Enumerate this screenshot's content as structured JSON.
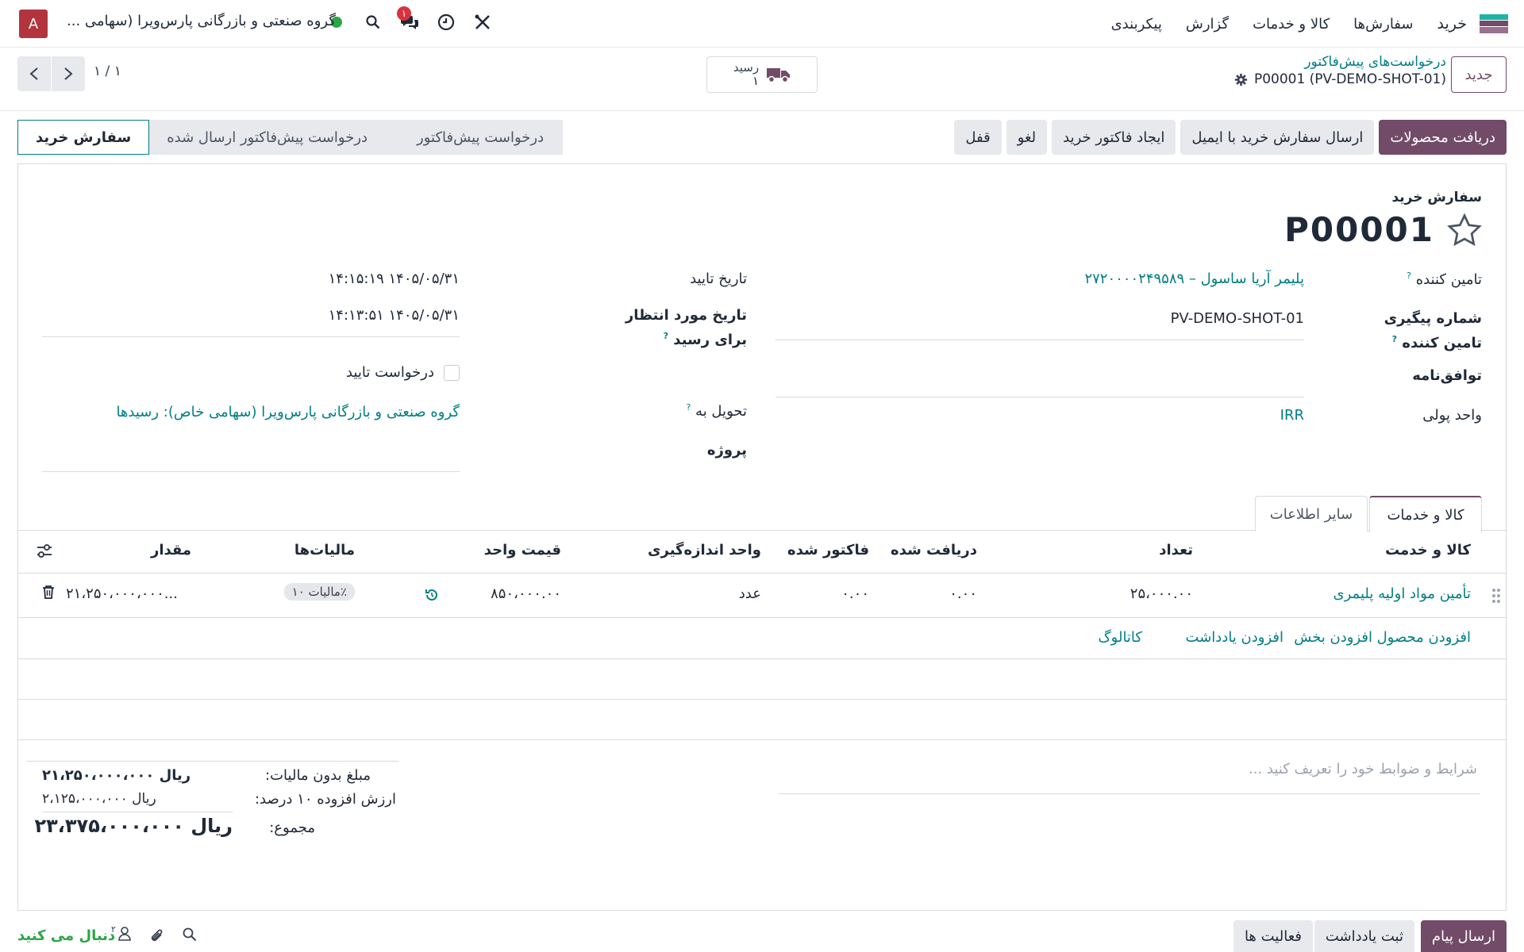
{
  "nav": {
    "app_name": "خرید",
    "menu": [
      "سفارش‌ها",
      "کالا و خدمات",
      "گزارش",
      "پیکربندی"
    ],
    "company": "گروه صنعتی و بازرگانی پارس‌ویرا (سهامی ...",
    "avatar_letter": "A",
    "message_badge": "۱"
  },
  "control": {
    "new_button": "جدید",
    "breadcrumb_parent": "درخواست‌های پیش‌فاکتور",
    "breadcrumb_current": "P00001 (PV-DEMO-SHOT-01)",
    "receipt_label": "رسید",
    "receipt_count": "۱",
    "pager": "۱ / ۱"
  },
  "actions": {
    "receive": "دریافت محصولات",
    "send_email": "ارسال سفارش خرید با ایمیل",
    "create_bill": "ایجاد فاکتور خرید",
    "cancel": "لغو",
    "lock": "قفل"
  },
  "status": {
    "steps": [
      "درخواست پیش‌فاکتور",
      "درخواست پیش‌فاکتور ارسال شده",
      "سفارش خرید"
    ],
    "active": "سفارش خرید"
  },
  "form": {
    "subtitle": "سفارش خرید",
    "name": "P00001",
    "vendor_label": "تامین کننده",
    "vendor_value": "پلیمر آریا ساسول – ۲۷۲۰۰۰۰۲۴۹۵۸۹",
    "vendor_ref_label": "شماره پیگیری تامین کننده",
    "vendor_ref_value": "PV-DEMO-SHOT-01",
    "agreement_label": "توافق‌نامه",
    "currency_label": "واحد پولی",
    "currency_value": "IRR",
    "confirm_date_label": "تاریخ تایید",
    "confirm_date_value": "۱۴۰۵/۰۵/۳۱ ۱۴:۱۵:۱۹",
    "expected_label": "تاریخ مورد انتظار برای رسید",
    "expected_value": "۱۴۰۵/۰۵/۳۱ ۱۴:۱۳:۵۱",
    "ask_confirm_label": "درخواست تایید",
    "deliver_to_label": "تحویل به",
    "deliver_to_value": "گروه صنعتی و بازرگانی پارس‌ویرا (سهامی خاص): رسیدها",
    "project_label": "پروژه"
  },
  "tabs": [
    "کالا و خدمات",
    "سایر اطلاعات"
  ],
  "lines": {
    "headers": {
      "product": "کالا و خدمت",
      "qty": "تعداد",
      "received": "دریافت شده",
      "billed": "فاکتور شده",
      "uom": "واحد اندازه‌گیری",
      "price": "قیمت واحد",
      "taxes": "مالیات‌ها",
      "amount": "مقدار"
    },
    "rows": [
      {
        "product": "تأمین مواد اولیه پلیمری",
        "qty": "۲۵،۰۰۰.۰۰",
        "received": "۰.۰۰",
        "billed": "۰.۰۰",
        "uom": "عدد",
        "price": "۸۵۰،۰۰۰.۰۰",
        "tax": "مالیات ۱۰٪",
        "amount": "۲۱،۲۵۰،۰۰۰،۰۰۰..."
      }
    ],
    "add_product": "افزودن محصول",
    "add_section": "افزودن بخش",
    "add_note": "افزودن یادداشت",
    "catalog": "کاتالوگ"
  },
  "totals": {
    "terms_placeholder": "شرایط و ضوابط خود را تعریف کنید ...",
    "untaxed_label": "مبلغ بدون مالیات:",
    "untaxed_value": "ریال ۲۱،۲۵۰،۰۰۰،۰۰۰",
    "vat_label": "ارزش افزوده ۱۰ درصد:",
    "vat_value": "ریال ۲،۱۲۵،۰۰۰،۰۰۰",
    "total_label": "مجموع:",
    "total_value": "ریال ۲۳،۳۷۵،۰۰۰،۰۰۰"
  },
  "chatter": {
    "send_message": "ارسال پیام",
    "log_note": "ثبت یادداشت",
    "activities": "فعالیت ها",
    "followers_count": "۲",
    "following": "دنبال می کنید"
  },
  "colors": {
    "primary": "#714b67",
    "link": "#017e84",
    "avatar": "#b4343d",
    "online": "#28a745"
  }
}
